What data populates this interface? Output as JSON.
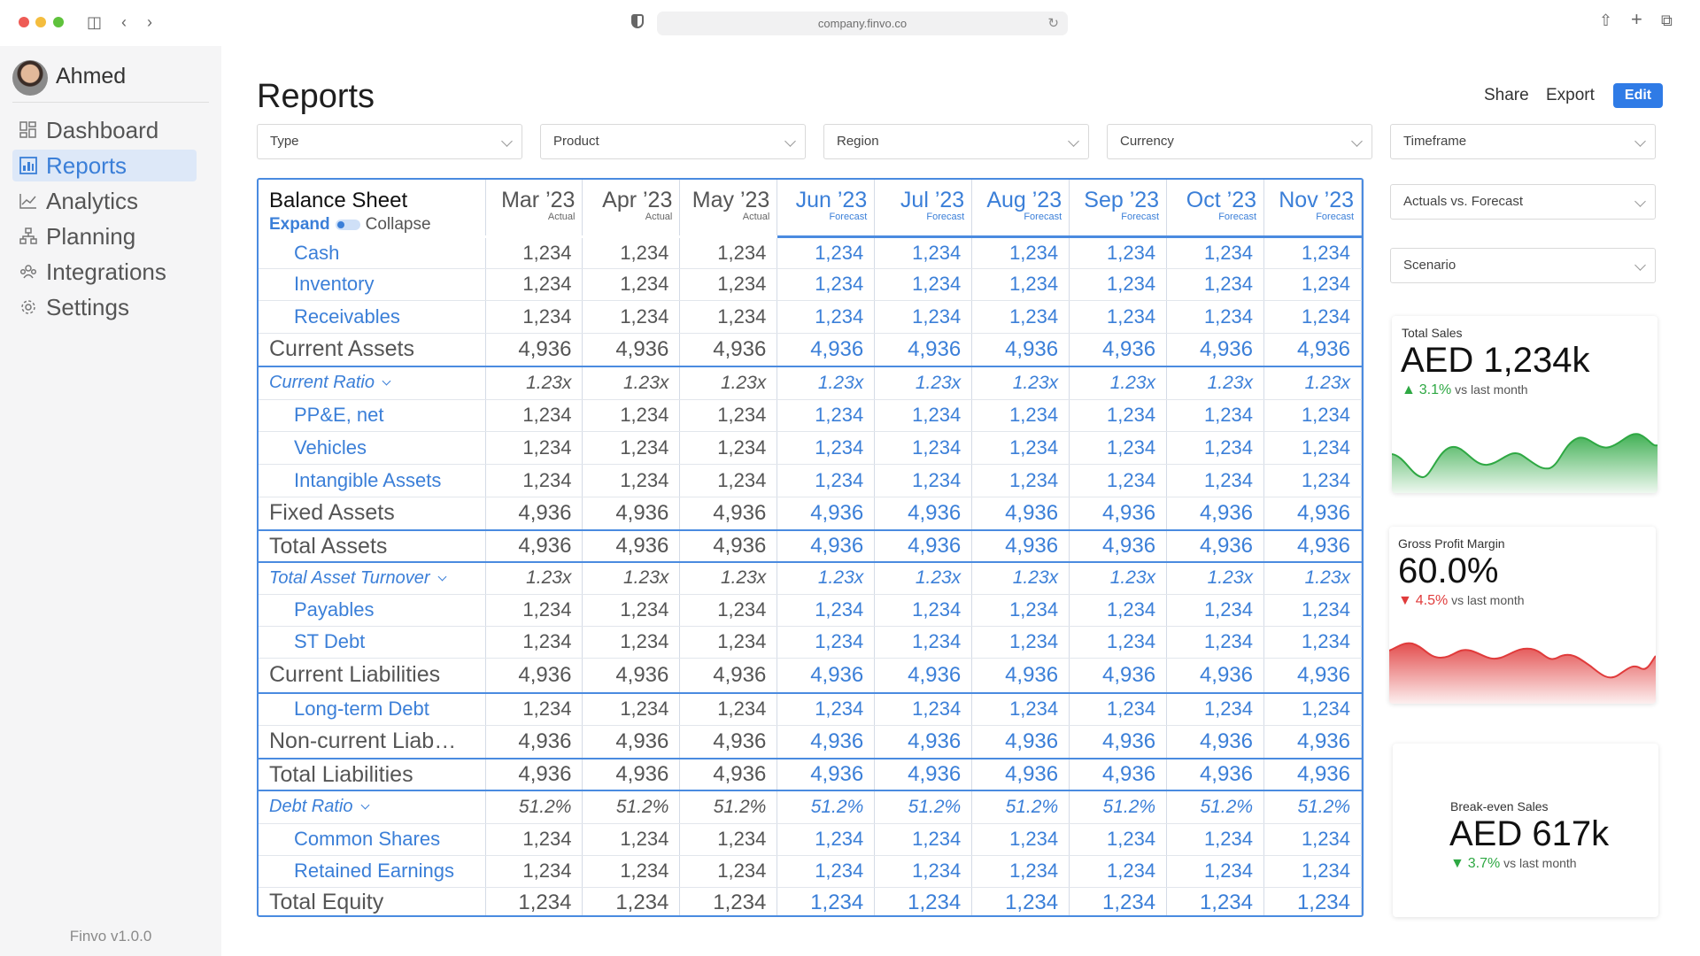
{
  "browser": {
    "url": "company.finvo.co"
  },
  "sidebar": {
    "user": "Ahmed",
    "items": [
      {
        "label": "Dashboard",
        "icon": "dashboard-icon",
        "active": false
      },
      {
        "label": "Reports",
        "icon": "reports-icon",
        "active": true
      },
      {
        "label": "Analytics",
        "icon": "analytics-icon",
        "active": false
      },
      {
        "label": "Planning",
        "icon": "planning-icon",
        "active": false
      },
      {
        "label": "Integrations",
        "icon": "integrations-icon",
        "active": false
      },
      {
        "label": "Settings",
        "icon": "settings-icon",
        "active": false
      }
    ],
    "version": "Finvo v1.0.0"
  },
  "header": {
    "title": "Reports",
    "share": "Share",
    "export": "Export",
    "edit": "Edit"
  },
  "filters": {
    "type": "Type",
    "product": "Product",
    "region": "Region",
    "currency": "Currency",
    "timeframe": "Timeframe",
    "actuals_vs_forecast": "Actuals vs. Forecast",
    "scenario": "Scenario"
  },
  "table": {
    "title": "Balance Sheet",
    "expand": "Expand",
    "collapse": "Collapse",
    "columns": [
      {
        "month": "Mar ’23",
        "type": "Actual",
        "forecast": false
      },
      {
        "month": "Apr ’23",
        "type": "Actual",
        "forecast": false
      },
      {
        "month": "May ’23",
        "type": "Actual",
        "forecast": false
      },
      {
        "month": "Jun ’23",
        "type": "Forecast",
        "forecast": true
      },
      {
        "month": "Jul ’23",
        "type": "Forecast",
        "forecast": true
      },
      {
        "month": "Aug ’23",
        "type": "Forecast",
        "forecast": true
      },
      {
        "month": "Sep ’23",
        "type": "Forecast",
        "forecast": true
      },
      {
        "month": "Oct ’23",
        "type": "Forecast",
        "forecast": true
      },
      {
        "month": "Nov ’23",
        "type": "Forecast",
        "forecast": true
      }
    ],
    "rows": [
      {
        "label": "Cash",
        "kind": "item",
        "value": "1,234",
        "h": 36
      },
      {
        "label": "Inventory",
        "kind": "item",
        "value": "1,234",
        "h": 36
      },
      {
        "label": "Receivables",
        "kind": "item",
        "value": "1,234",
        "h": 37
      },
      {
        "label": "Current Assets",
        "kind": "total",
        "value": "4,936",
        "h": 38
      },
      {
        "label": "Current Ratio",
        "kind": "ratio",
        "value": "1.23x",
        "h": 37
      },
      {
        "label": "PP&E, net",
        "kind": "item",
        "value": "1,234",
        "h": 36
      },
      {
        "label": "Vehicles",
        "kind": "item",
        "value": "1,234",
        "h": 37
      },
      {
        "label": "Intangible Assets",
        "kind": "item",
        "value": "1,234",
        "h": 37
      },
      {
        "label": "Fixed Assets",
        "kind": "total",
        "value": "4,936",
        "h": 38
      },
      {
        "label": "Total Assets",
        "kind": "total",
        "value": "4,936",
        "h": 36
      },
      {
        "label": "Total Asset Turnover",
        "kind": "ratio",
        "value": "1.23x",
        "h": 36
      },
      {
        "label": "Payables",
        "kind": "item",
        "value": "1,234",
        "h": 36
      },
      {
        "label": "ST Debt",
        "kind": "item",
        "value": "1,234",
        "h": 36
      },
      {
        "label": "Current Liabilities",
        "kind": "total",
        "value": "4,936",
        "h": 40
      },
      {
        "label": "Long-term Debt",
        "kind": "item",
        "value": "1,234",
        "h": 36
      },
      {
        "label": "Non-current Liab…",
        "kind": "total",
        "value": "4,936",
        "h": 38
      },
      {
        "label": "Total Liabilities",
        "kind": "total",
        "value": "4,936",
        "h": 36
      },
      {
        "label": "Debt Ratio",
        "kind": "ratio",
        "value": "51.2%",
        "h": 37
      },
      {
        "label": "Common Shares",
        "kind": "item",
        "value": "1,234",
        "h": 36
      },
      {
        "label": "Retained Earnings",
        "kind": "item",
        "value": "1,234",
        "h": 36
      },
      {
        "label": "Total Equity",
        "kind": "total",
        "value": "1,234",
        "h": 36
      }
    ]
  },
  "kpis": {
    "total_sales": {
      "title": "Total Sales",
      "value": "AED 1,234k",
      "delta": "3.1%",
      "suffix": "vs last month",
      "direction": "up",
      "color": "#2ea843"
    },
    "gross_margin": {
      "title": "Gross Profit Margin",
      "value": "60.0%",
      "delta": "4.5%",
      "suffix": "vs last month",
      "direction": "down",
      "color": "#e03b3b"
    },
    "break_even": {
      "title": "Break-even Sales",
      "value": "AED 617k",
      "delta": "3.7%",
      "suffix": "vs last month",
      "direction": "down",
      "color": "#2ea843"
    }
  },
  "colors": {
    "accent": "#3b7fd8",
    "edit_button": "#2f7be6",
    "positive": "#2ea843",
    "negative": "#e03b3b"
  }
}
